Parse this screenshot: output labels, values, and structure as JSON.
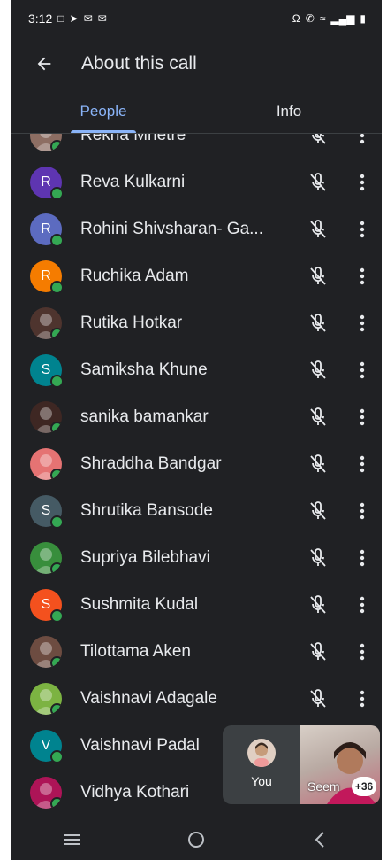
{
  "status_bar": {
    "time": "3:12"
  },
  "header": {
    "title": "About this call"
  },
  "tabs": [
    {
      "label": "People",
      "active": true
    },
    {
      "label": "Info",
      "active": false
    }
  ],
  "participants": [
    {
      "name": "Rekha Mhetre",
      "avatar": "photo",
      "color": "#8d6e63"
    },
    {
      "name": "Reva Kulkarni",
      "avatar": "initial",
      "initial": "R",
      "color": "#5e35b1"
    },
    {
      "name": "Rohini Shivsharan- Ga...",
      "avatar": "initial",
      "initial": "R",
      "color": "#5c6bc0"
    },
    {
      "name": "Ruchika Adam",
      "avatar": "initial",
      "initial": "R",
      "color": "#f57c00"
    },
    {
      "name": "Rutika Hotkar",
      "avatar": "photo",
      "color": "#4e342e"
    },
    {
      "name": "Samiksha Khune",
      "avatar": "initial",
      "initial": "S",
      "color": "#00838f"
    },
    {
      "name": "sanika bamankar",
      "avatar": "photo",
      "color": "#3e2723"
    },
    {
      "name": "Shraddha Bandgar",
      "avatar": "photo",
      "color": "#e57373"
    },
    {
      "name": "Shrutika Bansode",
      "avatar": "initial",
      "initial": "S",
      "color": "#455a64"
    },
    {
      "name": "Supriya Bilebhavi",
      "avatar": "photo",
      "color": "#388e3c"
    },
    {
      "name": "Sushmita Kudal",
      "avatar": "initial",
      "initial": "S",
      "color": "#f4511e"
    },
    {
      "name": "Tilottama Aken",
      "avatar": "photo",
      "color": "#6d4c41"
    },
    {
      "name": "Vaishnavi Adagale",
      "avatar": "photo",
      "color": "#7cb342"
    },
    {
      "name": "Vaishnavi Padal",
      "avatar": "initial",
      "initial": "V",
      "color": "#00838f"
    },
    {
      "name": "Vidhya Kothari",
      "avatar": "photo",
      "color": "#ad1457"
    }
  ],
  "pip": {
    "self_label": "You",
    "other_label": "Seem",
    "extra_count": "+36"
  },
  "icons": {
    "back": "arrow-left-icon",
    "muted": "mic-off-icon",
    "more": "more-vert-icon"
  }
}
